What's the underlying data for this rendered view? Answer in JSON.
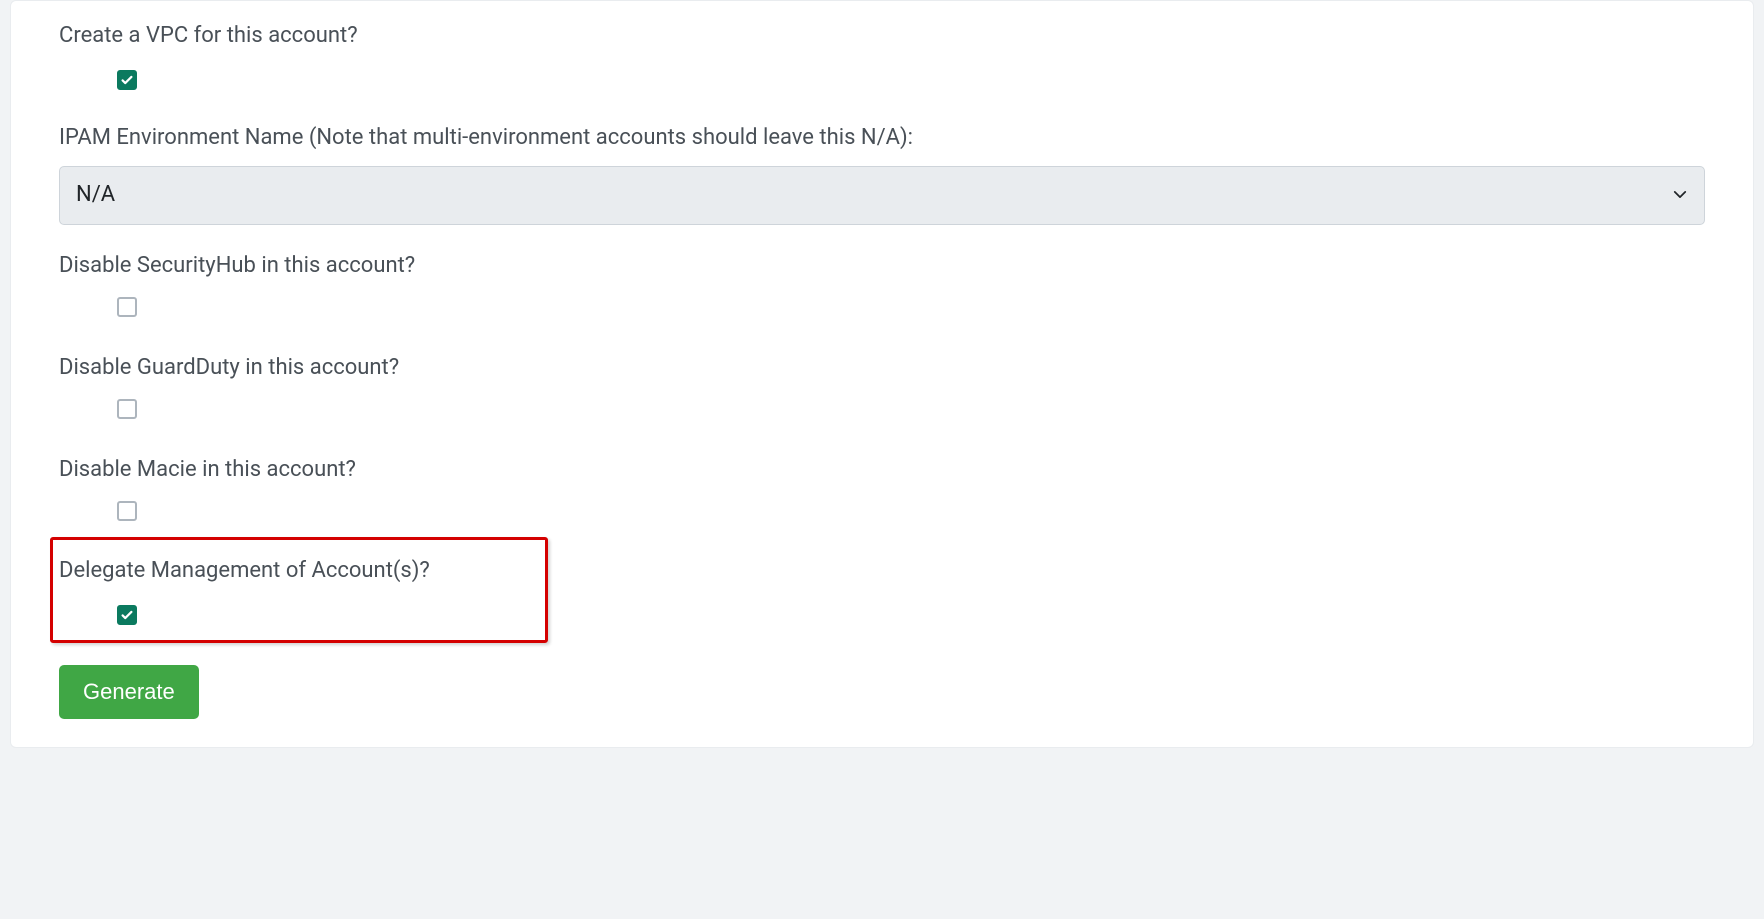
{
  "form": {
    "create_vpc": {
      "label": "Create a VPC for this account?",
      "checked": true
    },
    "ipam_env": {
      "label": "IPAM Environment Name (Note that multi-environment accounts should leave this N/A):",
      "selected": "N/A"
    },
    "disable_securityhub": {
      "label": "Disable SecurityHub in this account?",
      "checked": false
    },
    "disable_guardduty": {
      "label": "Disable GuardDuty in this account?",
      "checked": false
    },
    "disable_macie": {
      "label": "Disable Macie in this account?",
      "checked": false
    },
    "delegate_mgmt": {
      "label": "Delegate Management of Account(s)?",
      "checked": true
    },
    "generate_button": "Generate"
  }
}
